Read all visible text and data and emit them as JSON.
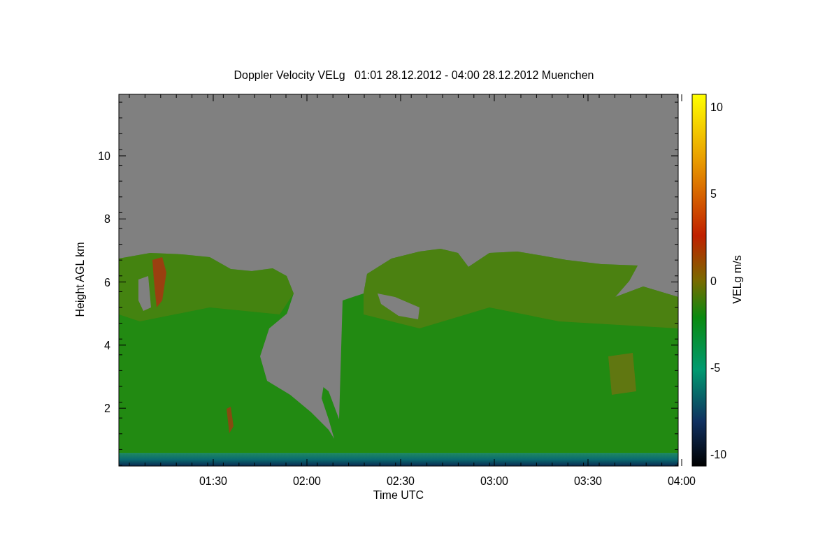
{
  "title": "Doppler Velocity VELg   01:01 28.12.2012 - 04:00 28.12.2012 Muenchen",
  "y_axis": {
    "label": "Height AGL km",
    "ticks": [
      "10",
      "8",
      "6",
      "4",
      "2"
    ]
  },
  "x_axis": {
    "label": "Time UTC",
    "ticks": [
      "01:30",
      "02:00",
      "02:30",
      "03:00",
      "03:30",
      "04:00"
    ]
  },
  "colorbar": {
    "label": "VELg m/s",
    "ticks": [
      "10",
      "5",
      "0",
      "-5",
      "-10"
    ]
  }
}
